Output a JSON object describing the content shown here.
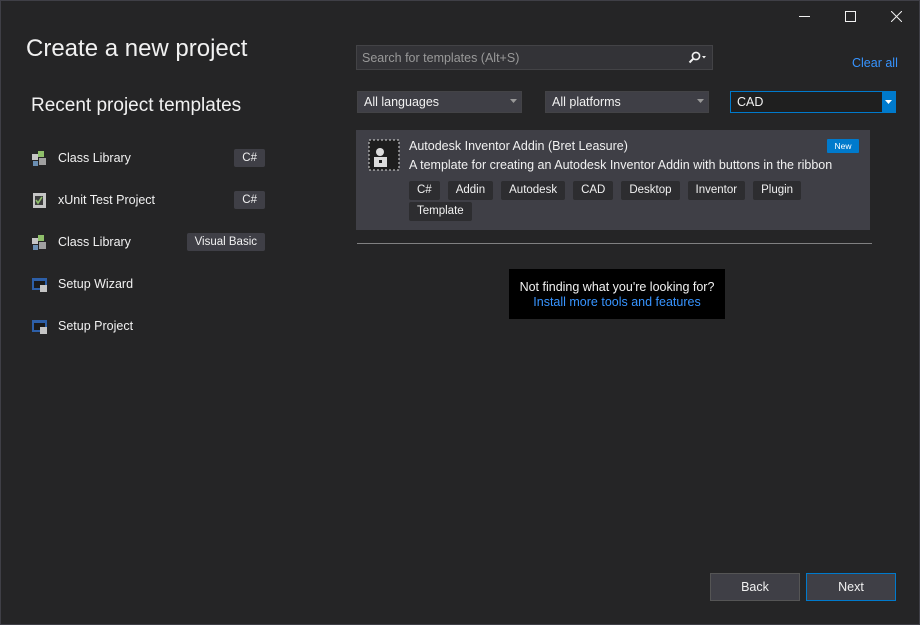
{
  "window": {
    "controls": [
      {
        "name": "minimize",
        "glyph": "—"
      },
      {
        "name": "maximize",
        "glyph": "☐"
      },
      {
        "name": "close",
        "glyph": "✕"
      }
    ]
  },
  "header": {
    "title": "Create a new project"
  },
  "recent": {
    "title": "Recent project templates",
    "items": [
      {
        "label": "Class Library",
        "tag": "C#",
        "icon": "class-library-icon"
      },
      {
        "label": "xUnit Test Project",
        "tag": "C#",
        "icon": "xunit-test-icon"
      },
      {
        "label": "Class Library",
        "tag": "Visual Basic",
        "icon": "class-library-icon"
      },
      {
        "label": "Setup Wizard",
        "tag": "",
        "icon": "setup-wizard-icon"
      },
      {
        "label": "Setup Project",
        "tag": "",
        "icon": "setup-project-icon"
      }
    ]
  },
  "search": {
    "placeholder": "Search for templates (Alt+S)",
    "value": "",
    "icon": "search-icon"
  },
  "clear_all": "Clear all",
  "filters": {
    "language": "All languages",
    "platform": "All platforms",
    "project_type": "CAD"
  },
  "template": {
    "name": "Autodesk Inventor Addin (Bret Leasure)",
    "description": "A template for creating an Autodesk Inventor Addin with buttons in the ribbon",
    "badge": "New",
    "tags": [
      "C#",
      "Addin",
      "Autodesk",
      "CAD",
      "Desktop",
      "Inventor",
      "Plugin",
      "Template"
    ]
  },
  "not_finding": {
    "text": "Not finding what you're looking for?",
    "link": "Install more tools and features"
  },
  "footer": {
    "back": "Back",
    "next": "Next"
  },
  "colors": {
    "accent": "#007acc",
    "link": "#3794ff",
    "background": "#252526"
  }
}
